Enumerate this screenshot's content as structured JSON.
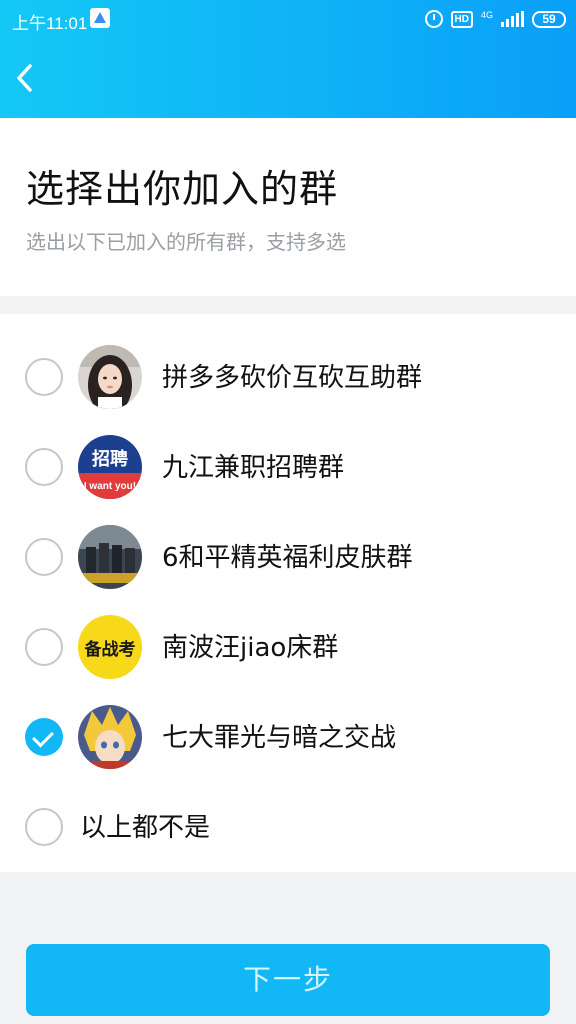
{
  "status_bar": {
    "time": "上午11:01",
    "hd": "HD",
    "network": "4G",
    "battery": "59"
  },
  "page": {
    "title": "选择出你加入的群",
    "subtitle": "选出以下已加入的所有群，支持多选"
  },
  "groups": [
    {
      "name": "拼多多砍价互砍互助群",
      "checked": false,
      "avatar": "avatar-girl-portrait"
    },
    {
      "name": "九江兼职招聘群",
      "checked": false,
      "avatar": "avatar-recruit-banner",
      "avatar_text_main": "招聘",
      "avatar_text_sub": "I want you!"
    },
    {
      "name": "6和平精英福利皮肤群",
      "checked": false,
      "avatar": "avatar-soldiers-group"
    },
    {
      "name": "南波汪jiao床群",
      "checked": false,
      "avatar": "avatar-yellow-calligraphy",
      "avatar_text_main": "备战考"
    },
    {
      "name": "七大罪光与暗之交战",
      "checked": true,
      "avatar": "avatar-anime-hero"
    },
    {
      "name": "以上都不是",
      "checked": false
    }
  ],
  "next_button": {
    "label": "下一步"
  },
  "colors": {
    "accent": "#12b7f5",
    "header_start": "#14c8f6",
    "header_end": "#0a9ff8"
  }
}
